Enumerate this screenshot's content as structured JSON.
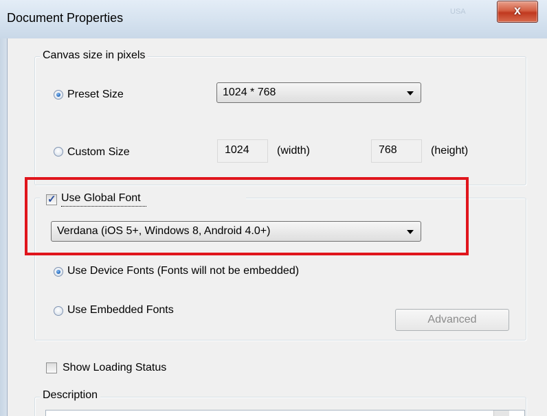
{
  "window": {
    "title": "Document Properties",
    "close_glyph": "x",
    "title_decoration": "USA"
  },
  "canvas_size": {
    "legend": "Canvas size in pixels",
    "preset_label": "Preset Size",
    "preset_selected": true,
    "preset_value": "1024 * 768",
    "custom_label": "Custom Size",
    "custom_selected": false,
    "width_value": "1024",
    "width_unit": "(width)",
    "height_value": "768",
    "height_unit": "(height)"
  },
  "font": {
    "use_global_font_label": "Use Global Font",
    "use_global_font_checked": true,
    "font_value": "Verdana (iOS 5+, Windows 8, Android 4.0+)",
    "device_fonts_label": "Use Device Fonts (Fonts will not be embedded)",
    "device_fonts_selected": true,
    "embedded_fonts_label": "Use Embedded Fonts",
    "embedded_fonts_selected": false,
    "advanced_label": "Advanced"
  },
  "loading": {
    "show_loading_status_label": "Show Loading Status",
    "show_loading_status_checked": false
  },
  "description": {
    "legend": "Description"
  },
  "annotation": {
    "highlight_color": "#e0151c"
  }
}
